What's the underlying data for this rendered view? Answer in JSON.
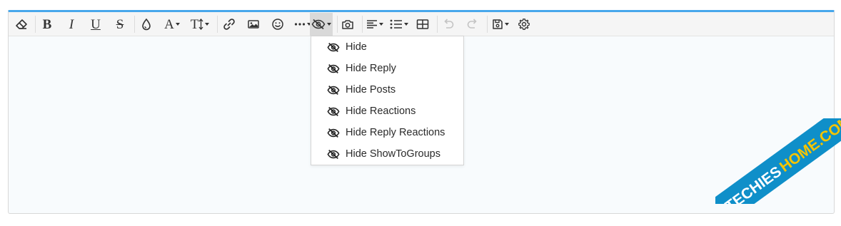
{
  "toolbar": {
    "buttons": [
      {
        "name": "remove-format-icon"
      },
      {
        "name": "bold-icon",
        "letter": "B"
      },
      {
        "name": "italic-icon",
        "letter": "I"
      },
      {
        "name": "underline-icon",
        "letter": "U"
      },
      {
        "name": "strikethrough-icon",
        "letter": "S"
      },
      {
        "name": "text-color-icon"
      },
      {
        "name": "font-family-icon",
        "letter": "A"
      },
      {
        "name": "font-size-icon",
        "letter": "T"
      },
      {
        "name": "link-icon"
      },
      {
        "name": "image-icon"
      },
      {
        "name": "emoji-icon"
      },
      {
        "name": "more-options-icon"
      },
      {
        "name": "hide-icon",
        "active": true
      },
      {
        "name": "camera-icon"
      },
      {
        "name": "align-icon"
      },
      {
        "name": "list-icon"
      },
      {
        "name": "table-icon"
      },
      {
        "name": "undo-icon",
        "disabled": true
      },
      {
        "name": "redo-icon",
        "disabled": true
      },
      {
        "name": "drafts-icon"
      },
      {
        "name": "settings-icon"
      }
    ]
  },
  "hide_menu": {
    "items": [
      {
        "label": "Hide",
        "icon": "eye-slash-icon"
      },
      {
        "label": "Hide Reply",
        "icon": "eye-slash-icon"
      },
      {
        "label": "Hide Posts",
        "icon": "eye-slash-icon"
      },
      {
        "label": "Hide Reactions",
        "icon": "eye-slash-icon"
      },
      {
        "label": "Hide Reply Reactions",
        "icon": "eye-slash-icon"
      },
      {
        "label": "Hide ShowToGroups",
        "icon": "eye-slash-icon"
      }
    ]
  },
  "watermark": {
    "text_1": "TECHIES",
    "text_2": "HOME.COM"
  },
  "colors": {
    "accent": "#47a7eb",
    "watermark_bg": "#0f8fc9",
    "watermark_text_2": "#f5c400"
  }
}
